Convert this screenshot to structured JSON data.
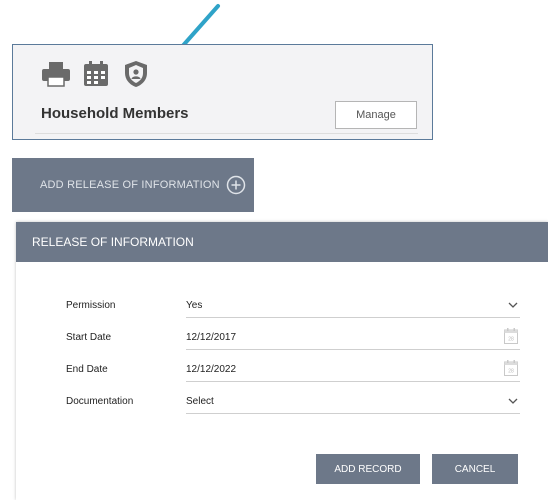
{
  "panel": {
    "title": "Household Members",
    "manage_label": "Manage",
    "icons": [
      "printer-icon",
      "calendar-icon",
      "shield-icon"
    ]
  },
  "add_release": {
    "label": "ADD RELEASE OF INFORMATION",
    "icon": "plus-circle-icon"
  },
  "form": {
    "header": "RELEASE OF INFORMATION",
    "fields": [
      {
        "label": "Permission",
        "value": "Yes",
        "control": "select"
      },
      {
        "label": "Start Date",
        "value": "12/12/2017",
        "control": "date"
      },
      {
        "label": "End Date",
        "value": "12/12/2022",
        "control": "date"
      },
      {
        "label": "Documentation",
        "value": "Select",
        "control": "select"
      }
    ],
    "add_record_label": "ADD RECORD",
    "cancel_label": "CANCEL"
  },
  "colors": {
    "arrow": "#2fa3c8",
    "bar": "#6d7889",
    "panel_border": "#5b7a9a"
  }
}
